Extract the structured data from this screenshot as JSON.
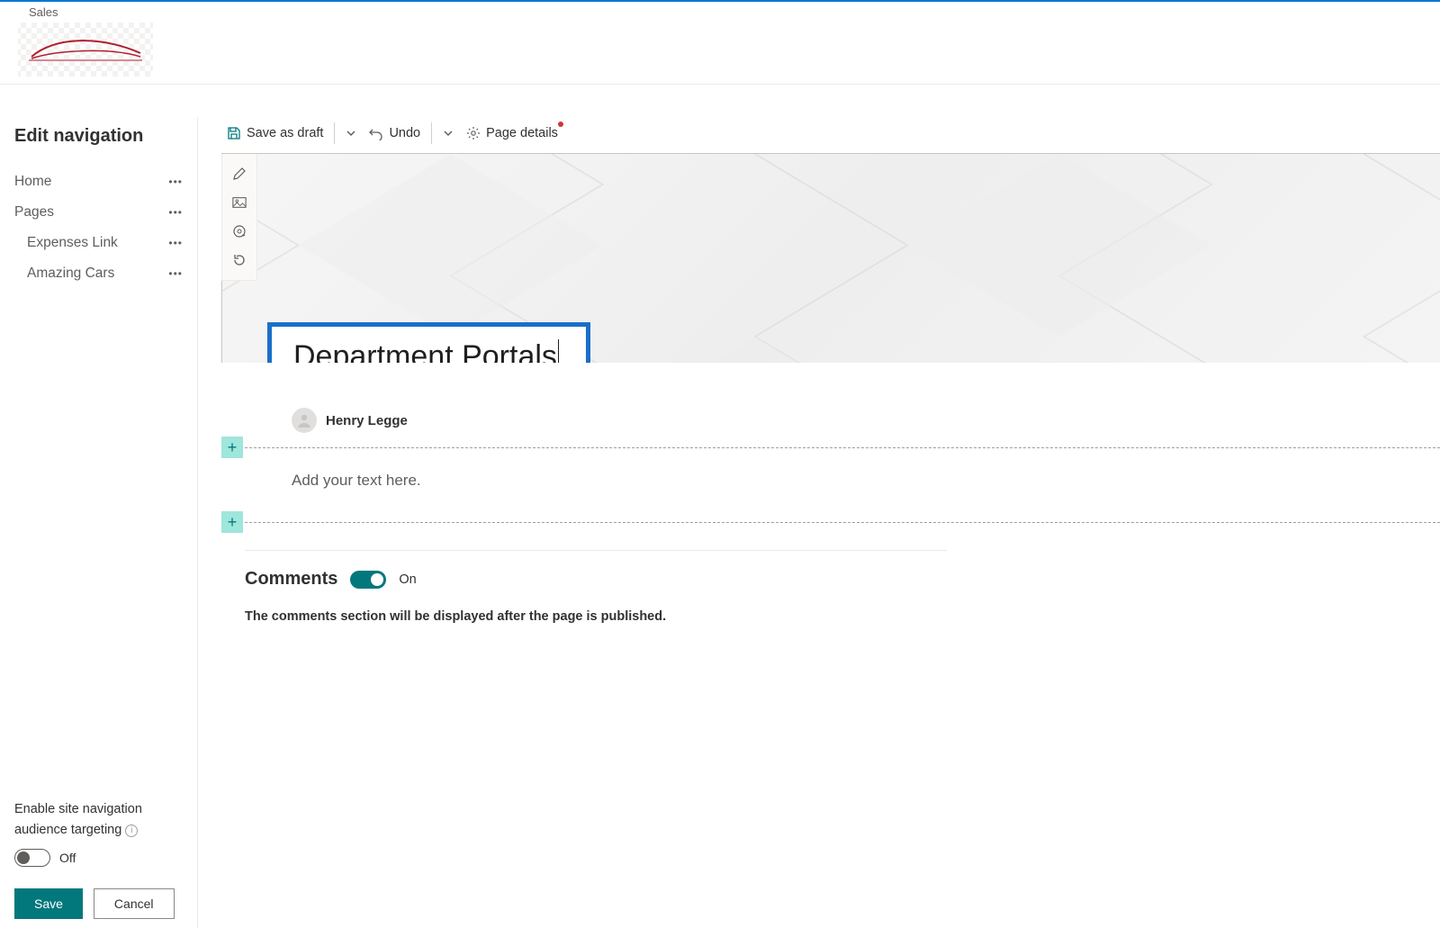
{
  "topbar": {
    "site_label": "Sales"
  },
  "sidebar": {
    "title": "Edit navigation",
    "items": [
      {
        "label": "Home",
        "sub": false
      },
      {
        "label": "Pages",
        "sub": false
      },
      {
        "label": "Expenses Link",
        "sub": true
      },
      {
        "label": "Amazing Cars",
        "sub": true
      }
    ],
    "audience_label_1": "Enable site navigation",
    "audience_label_2": "audience targeting",
    "audience_state": "Off",
    "save_label": "Save",
    "cancel_label": "Cancel"
  },
  "cmdbar": {
    "save_draft": "Save as draft",
    "undo": "Undo",
    "page_details": "Page details"
  },
  "page": {
    "title": "Department Portals",
    "author": "Henry Legge",
    "text_placeholder": "Add your text here."
  },
  "comments": {
    "title": "Comments",
    "state": "On",
    "note": "The comments section will be displayed after the page is published."
  }
}
